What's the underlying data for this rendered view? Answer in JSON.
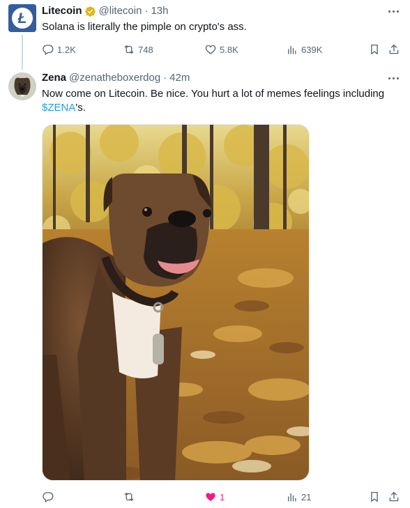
{
  "tweets": [
    {
      "name": "Litecoin",
      "handle": "@litecoin",
      "separator": "·",
      "time": "13h",
      "text": "Solana is literally the pimple on crypto's ass.",
      "counts": {
        "reply": "1.2K",
        "retweet": "748",
        "like": "5.8K",
        "views": "639K"
      },
      "avatar_icon": "litecoin-logo",
      "verified_icon": "gold-verified-badge"
    },
    {
      "name": "Zena",
      "handle": "@zenatheboxerdog",
      "separator": "·",
      "time": "42m",
      "text_before": "Now come on Litecoin.  Be nice.  You hurt a lot of memes feelings including ",
      "cashtag": "$ZENA",
      "text_after": "'s.",
      "counts": {
        "reply": "",
        "retweet": "",
        "like": "1",
        "views": "21"
      },
      "liked": true,
      "media_description_icon": "boxer-dog-autumn-photo"
    }
  ],
  "colors": {
    "text": "#0f1419",
    "secondary": "#536471",
    "link": "#1d9bf0",
    "like": "#f91880",
    "litecoin_blue": "#345d9d",
    "verified_gold": "#e2b719"
  }
}
